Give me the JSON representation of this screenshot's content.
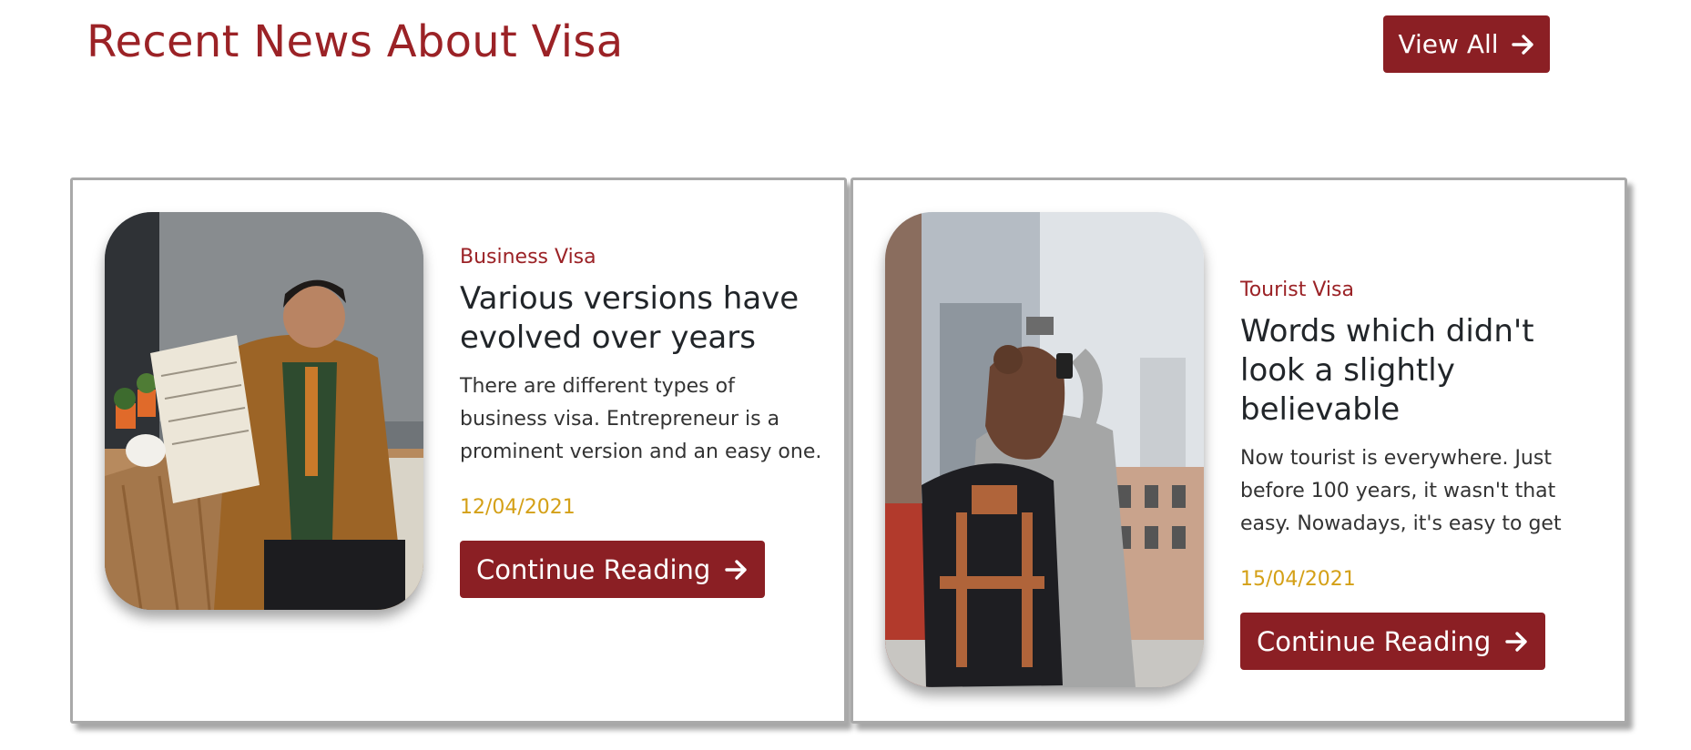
{
  "header": {
    "title": "Recent News About Visa",
    "view_all_label": "View All"
  },
  "cards": [
    {
      "category": "Business Visa",
      "title": "Various versions have evolved over years",
      "description": "There are different types of business visa. Entrepreneur is a prominent version and an easy one.",
      "date": "12/04/2021",
      "button_label": "Continue Reading"
    },
    {
      "category": "Tourist Visa",
      "title": "Words which didn't look a slightly believable",
      "description": "Now tourist is everywhere. Just before 100 years, it wasn't that easy. Nowadays, it's easy to get",
      "date": "15/04/2021",
      "button_label": "Continue Reading"
    }
  ],
  "colors": {
    "brand_red": "#8b1f24",
    "title_red": "#9b2226",
    "date_gold": "#d4a017",
    "text_dark": "#212529"
  },
  "icons": {
    "arrow": "arrow-right-icon"
  }
}
